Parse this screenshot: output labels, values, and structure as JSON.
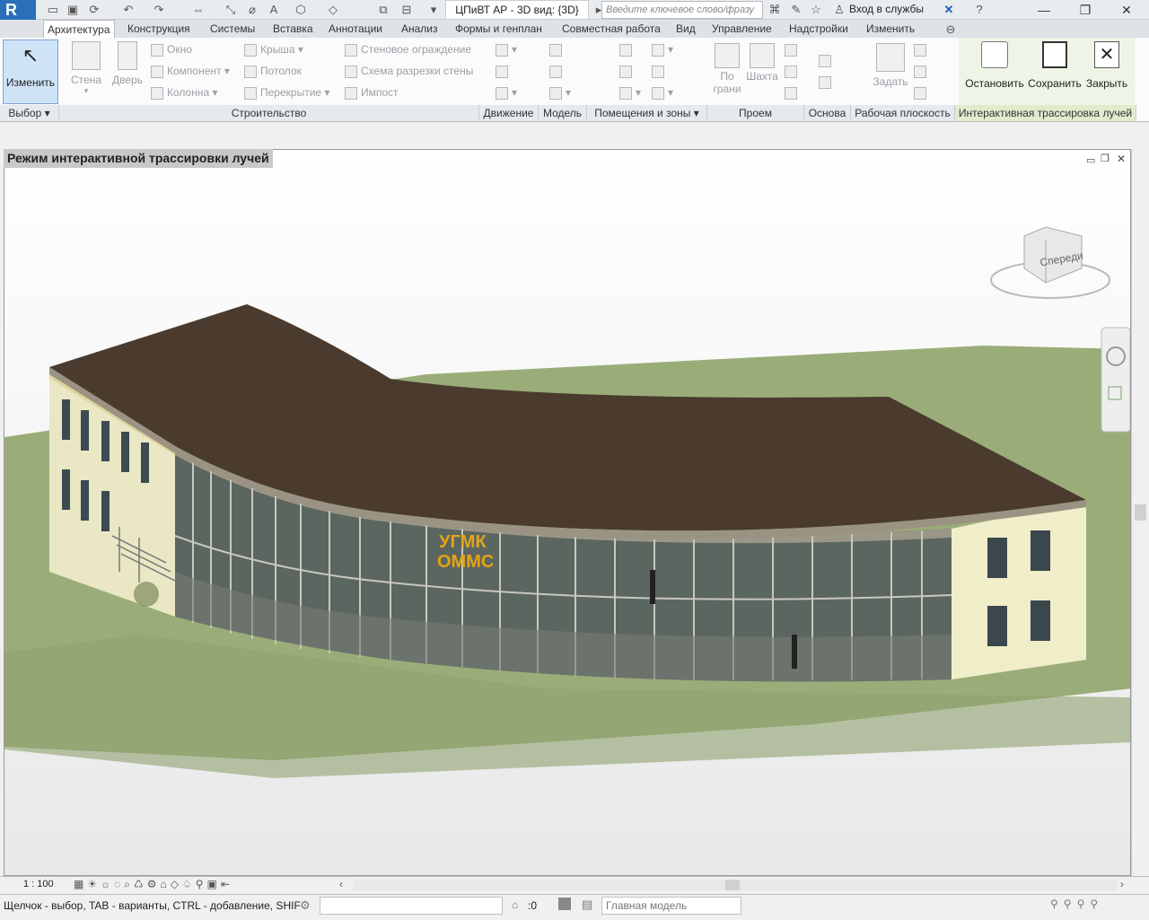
{
  "app": {
    "logo": "R",
    "title": "ЦПиВТ АР - 3D вид: {3D}"
  },
  "search": {
    "placeholder": "Введите ключевое слово/фразу"
  },
  "account": {
    "login_label": "Вход в службы"
  },
  "tabs": [
    "Архитектура",
    "Конструкция",
    "Системы",
    "Вставка",
    "Аннотации",
    "Анализ",
    "Формы и генплан",
    "Совместная работа",
    "Вид",
    "Управление",
    "Надстройки",
    "Изменить"
  ],
  "ribbon": {
    "modify_label": "Изменить",
    "wall_label": "Стена",
    "door_label": "Дверь",
    "col1": [
      "Окно",
      "Компонент",
      "Колонна"
    ],
    "col2": [
      "Крыша",
      "Потолок",
      "Перекрытие"
    ],
    "col3": [
      "Стеновое ограждение",
      "Схема разрезки стены",
      "Импост"
    ],
    "face_label_1": "По",
    "face_label_2": "грани",
    "shaft_label": "Шахта",
    "set_label": "Задать",
    "stop_label": "Остановить",
    "save_label": "Сохранить",
    "close_label": "Закрыть",
    "groups": {
      "select": "Выбор",
      "build": "Строительство",
      "circulation": "Движение",
      "model": "Модель",
      "rooms": "Помещения и зоны",
      "opening": "Проем",
      "datum": "Основа",
      "workplane": "Рабочая плоскость",
      "raytrace": "Интерактивная трассировка лучей"
    }
  },
  "view": {
    "title": "Режим интерактивной трассировки лучей",
    "viewcube_label": "Спереди",
    "sign_line1": "УГМК",
    "sign_line2": "ОММС"
  },
  "viewbar": {
    "scale": "1 : 100"
  },
  "status": {
    "hint": "Щелчок - выбор, TAB - варианты, CTRL - добавление, SHIF",
    "zero": ":0",
    "model": "Главная модель"
  },
  "colors": {
    "roof": "#4a3b2e",
    "grass": "#9db07a",
    "facade": "#efeec8",
    "ribbon_active": "#cfe3f7"
  }
}
